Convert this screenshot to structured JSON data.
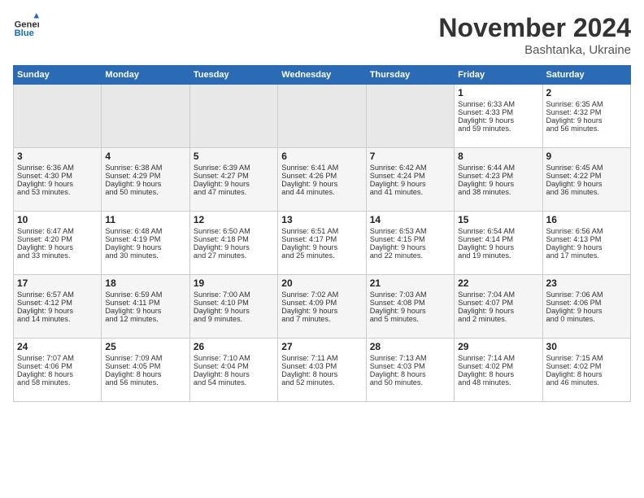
{
  "logo": {
    "line1": "General",
    "line2": "Blue"
  },
  "title": "November 2024",
  "location": "Bashtanka, Ukraine",
  "headers": [
    "Sunday",
    "Monday",
    "Tuesday",
    "Wednesday",
    "Thursday",
    "Friday",
    "Saturday"
  ],
  "weeks": [
    [
      {
        "day": "",
        "data": []
      },
      {
        "day": "",
        "data": []
      },
      {
        "day": "",
        "data": []
      },
      {
        "day": "",
        "data": []
      },
      {
        "day": "",
        "data": []
      },
      {
        "day": "1",
        "data": [
          "Sunrise: 6:33 AM",
          "Sunset: 4:33 PM",
          "Daylight: 9 hours",
          "and 59 minutes."
        ]
      },
      {
        "day": "2",
        "data": [
          "Sunrise: 6:35 AM",
          "Sunset: 4:32 PM",
          "Daylight: 9 hours",
          "and 56 minutes."
        ]
      }
    ],
    [
      {
        "day": "3",
        "data": [
          "Sunrise: 6:36 AM",
          "Sunset: 4:30 PM",
          "Daylight: 9 hours",
          "and 53 minutes."
        ]
      },
      {
        "day": "4",
        "data": [
          "Sunrise: 6:38 AM",
          "Sunset: 4:29 PM",
          "Daylight: 9 hours",
          "and 50 minutes."
        ]
      },
      {
        "day": "5",
        "data": [
          "Sunrise: 6:39 AM",
          "Sunset: 4:27 PM",
          "Daylight: 9 hours",
          "and 47 minutes."
        ]
      },
      {
        "day": "6",
        "data": [
          "Sunrise: 6:41 AM",
          "Sunset: 4:26 PM",
          "Daylight: 9 hours",
          "and 44 minutes."
        ]
      },
      {
        "day": "7",
        "data": [
          "Sunrise: 6:42 AM",
          "Sunset: 4:24 PM",
          "Daylight: 9 hours",
          "and 41 minutes."
        ]
      },
      {
        "day": "8",
        "data": [
          "Sunrise: 6:44 AM",
          "Sunset: 4:23 PM",
          "Daylight: 9 hours",
          "and 38 minutes."
        ]
      },
      {
        "day": "9",
        "data": [
          "Sunrise: 6:45 AM",
          "Sunset: 4:22 PM",
          "Daylight: 9 hours",
          "and 36 minutes."
        ]
      }
    ],
    [
      {
        "day": "10",
        "data": [
          "Sunrise: 6:47 AM",
          "Sunset: 4:20 PM",
          "Daylight: 9 hours",
          "and 33 minutes."
        ]
      },
      {
        "day": "11",
        "data": [
          "Sunrise: 6:48 AM",
          "Sunset: 4:19 PM",
          "Daylight: 9 hours",
          "and 30 minutes."
        ]
      },
      {
        "day": "12",
        "data": [
          "Sunrise: 6:50 AM",
          "Sunset: 4:18 PM",
          "Daylight: 9 hours",
          "and 27 minutes."
        ]
      },
      {
        "day": "13",
        "data": [
          "Sunrise: 6:51 AM",
          "Sunset: 4:17 PM",
          "Daylight: 9 hours",
          "and 25 minutes."
        ]
      },
      {
        "day": "14",
        "data": [
          "Sunrise: 6:53 AM",
          "Sunset: 4:15 PM",
          "Daylight: 9 hours",
          "and 22 minutes."
        ]
      },
      {
        "day": "15",
        "data": [
          "Sunrise: 6:54 AM",
          "Sunset: 4:14 PM",
          "Daylight: 9 hours",
          "and 19 minutes."
        ]
      },
      {
        "day": "16",
        "data": [
          "Sunrise: 6:56 AM",
          "Sunset: 4:13 PM",
          "Daylight: 9 hours",
          "and 17 minutes."
        ]
      }
    ],
    [
      {
        "day": "17",
        "data": [
          "Sunrise: 6:57 AM",
          "Sunset: 4:12 PM",
          "Daylight: 9 hours",
          "and 14 minutes."
        ]
      },
      {
        "day": "18",
        "data": [
          "Sunrise: 6:59 AM",
          "Sunset: 4:11 PM",
          "Daylight: 9 hours",
          "and 12 minutes."
        ]
      },
      {
        "day": "19",
        "data": [
          "Sunrise: 7:00 AM",
          "Sunset: 4:10 PM",
          "Daylight: 9 hours",
          "and 9 minutes."
        ]
      },
      {
        "day": "20",
        "data": [
          "Sunrise: 7:02 AM",
          "Sunset: 4:09 PM",
          "Daylight: 9 hours",
          "and 7 minutes."
        ]
      },
      {
        "day": "21",
        "data": [
          "Sunrise: 7:03 AM",
          "Sunset: 4:08 PM",
          "Daylight: 9 hours",
          "and 5 minutes."
        ]
      },
      {
        "day": "22",
        "data": [
          "Sunrise: 7:04 AM",
          "Sunset: 4:07 PM",
          "Daylight: 9 hours",
          "and 2 minutes."
        ]
      },
      {
        "day": "23",
        "data": [
          "Sunrise: 7:06 AM",
          "Sunset: 4:06 PM",
          "Daylight: 9 hours",
          "and 0 minutes."
        ]
      }
    ],
    [
      {
        "day": "24",
        "data": [
          "Sunrise: 7:07 AM",
          "Sunset: 4:06 PM",
          "Daylight: 8 hours",
          "and 58 minutes."
        ]
      },
      {
        "day": "25",
        "data": [
          "Sunrise: 7:09 AM",
          "Sunset: 4:05 PM",
          "Daylight: 8 hours",
          "and 56 minutes."
        ]
      },
      {
        "day": "26",
        "data": [
          "Sunrise: 7:10 AM",
          "Sunset: 4:04 PM",
          "Daylight: 8 hours",
          "and 54 minutes."
        ]
      },
      {
        "day": "27",
        "data": [
          "Sunrise: 7:11 AM",
          "Sunset: 4:03 PM",
          "Daylight: 8 hours",
          "and 52 minutes."
        ]
      },
      {
        "day": "28",
        "data": [
          "Sunrise: 7:13 AM",
          "Sunset: 4:03 PM",
          "Daylight: 8 hours",
          "and 50 minutes."
        ]
      },
      {
        "day": "29",
        "data": [
          "Sunrise: 7:14 AM",
          "Sunset: 4:02 PM",
          "Daylight: 8 hours",
          "and 48 minutes."
        ]
      },
      {
        "day": "30",
        "data": [
          "Sunrise: 7:15 AM",
          "Sunset: 4:02 PM",
          "Daylight: 8 hours",
          "and 46 minutes."
        ]
      }
    ]
  ]
}
